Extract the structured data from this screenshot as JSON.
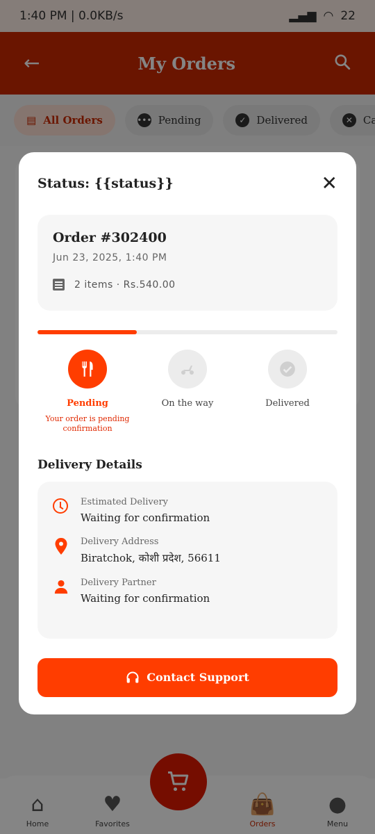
{
  "status_bar": {
    "time": "1:40 PM | 0.0KB/s",
    "battery": "22"
  },
  "appbar": {
    "title": "My Orders"
  },
  "filters": [
    {
      "label": "All Orders",
      "active": true
    },
    {
      "label": "Pending",
      "active": false
    },
    {
      "label": "Delivered",
      "active": false
    },
    {
      "label": "Cancelled",
      "active": false
    }
  ],
  "modal": {
    "title": "Status: {{status}}",
    "order": {
      "number": "Order #302400",
      "date": "Jun 23, 2025, 1:40 PM",
      "items": "2 items · Rs.540.00"
    },
    "progress": 0.33,
    "steps": [
      {
        "label": "Pending",
        "sub": "Your order is pending confirmation",
        "active": true,
        "icon": "restaurant-icon"
      },
      {
        "label": "On the way",
        "sub": "",
        "active": false,
        "icon": "scooter-icon"
      },
      {
        "label": "Delivered",
        "sub": "",
        "active": false,
        "icon": "check-circle-icon"
      }
    ],
    "delivery_title": "Delivery Details",
    "details": [
      {
        "label": "Estimated Delivery",
        "value": "Waiting for confirmation",
        "icon": "clock-icon"
      },
      {
        "label": "Delivery Address",
        "value": "Biratchok, कोशी प्रदेश, 56611",
        "icon": "location-pin-icon"
      },
      {
        "label": "Delivery Partner",
        "value": "Waiting for confirmation",
        "icon": "person-icon"
      }
    ],
    "support_label": "Contact Support"
  },
  "bottom_nav": [
    {
      "label": "Home",
      "icon": "home-icon",
      "active": false
    },
    {
      "label": "Favorites",
      "icon": "heart-icon",
      "active": false
    },
    {
      "label": "Orders",
      "icon": "bag-icon",
      "active": true
    },
    {
      "label": "Menu",
      "icon": "person-icon",
      "active": false
    }
  ],
  "colors": {
    "primary": "#ff3d00",
    "appbar": "#cc2a00"
  }
}
